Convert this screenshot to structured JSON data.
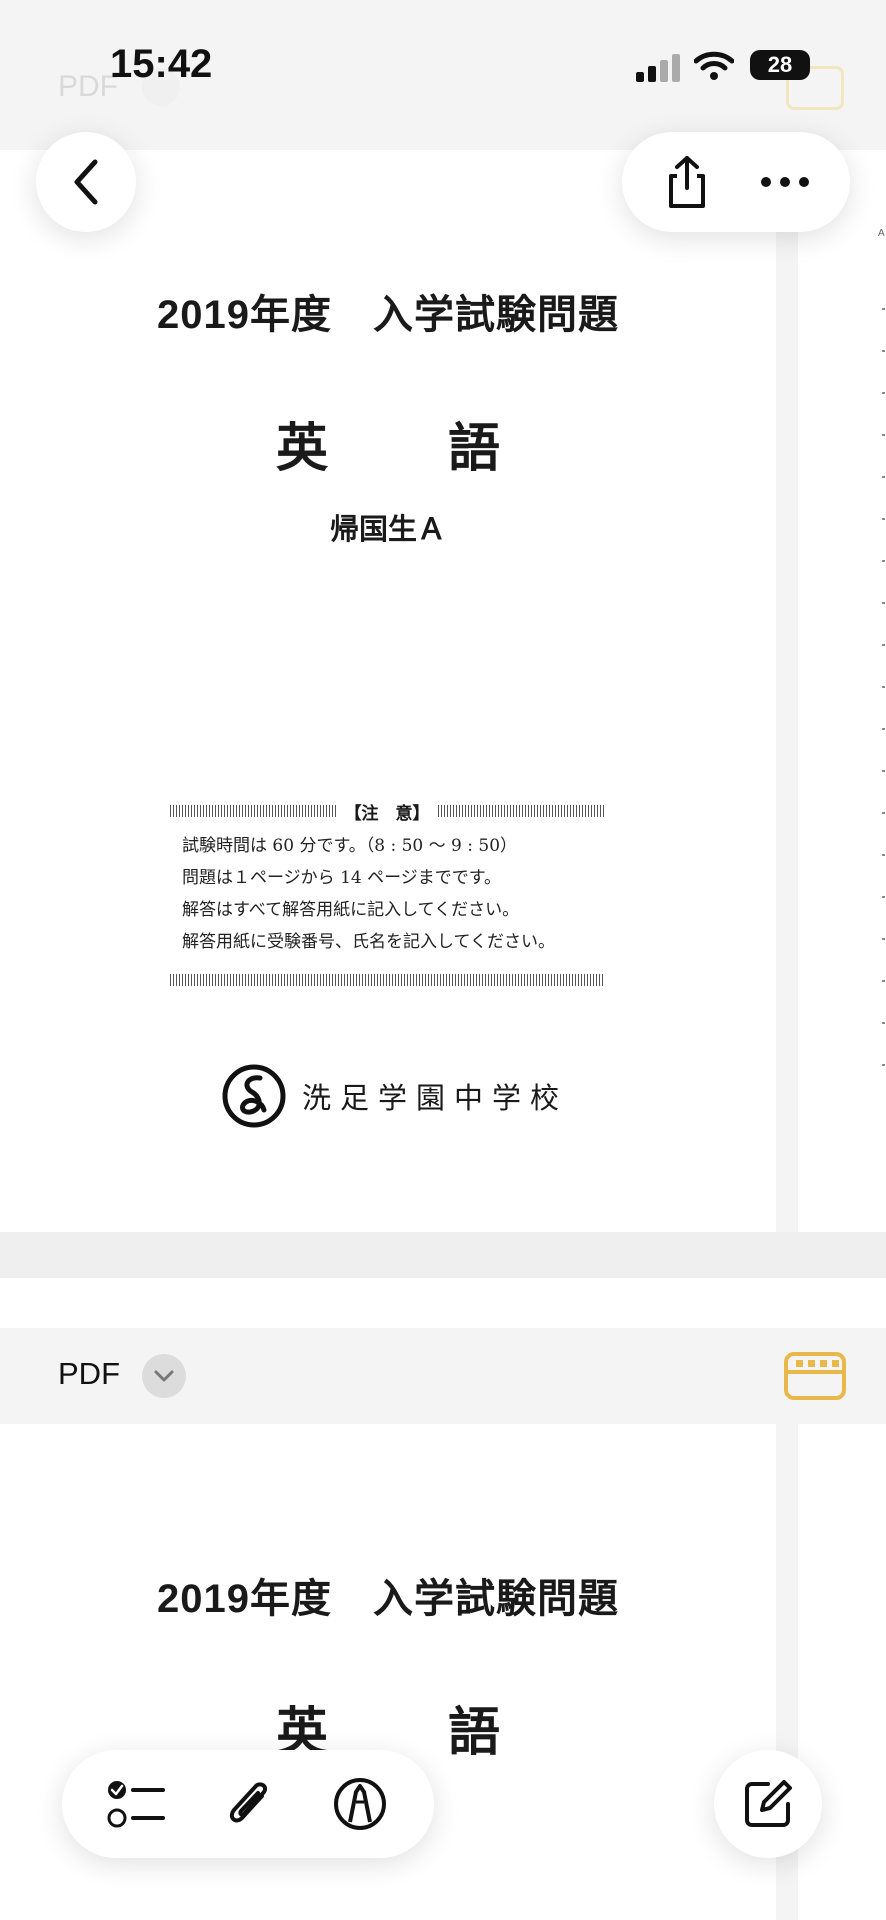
{
  "status_bar": {
    "time": "15:42",
    "battery": "28"
  },
  "faded_header": {
    "label": "PDF"
  },
  "document": {
    "title": "2019年度　入学試験問題",
    "subject_left": "英",
    "subject_right": "語",
    "category": "帰国生Ａ",
    "notice": {
      "heading": "【注　意】",
      "lines": [
        "試験時間は 60 分です。（8 : 50 ～ 9 : 50）",
        "問題は１ページから 14 ページまでです。",
        "解答はすべて解答用紙に記入してください。",
        "解答用紙に受験番号、氏名を記入してください。"
      ]
    },
    "school_name": "洗足学園中学校"
  },
  "pdf_bar": {
    "label": "PDF"
  },
  "page2": {
    "title": "2019年度　入学試験問題",
    "subject_left": "英",
    "subject_right": "語"
  },
  "icons": {
    "back": "chevron-left-icon",
    "share": "share-icon",
    "more": "ellipsis-icon",
    "checklist": "checklist-icon",
    "attach": "paperclip-icon",
    "markup": "pen-circle-icon",
    "compose": "compose-icon",
    "calendar": "calendar-icon"
  },
  "colors": {
    "accent": "#E8B84A",
    "background": "#F4F4F4"
  }
}
